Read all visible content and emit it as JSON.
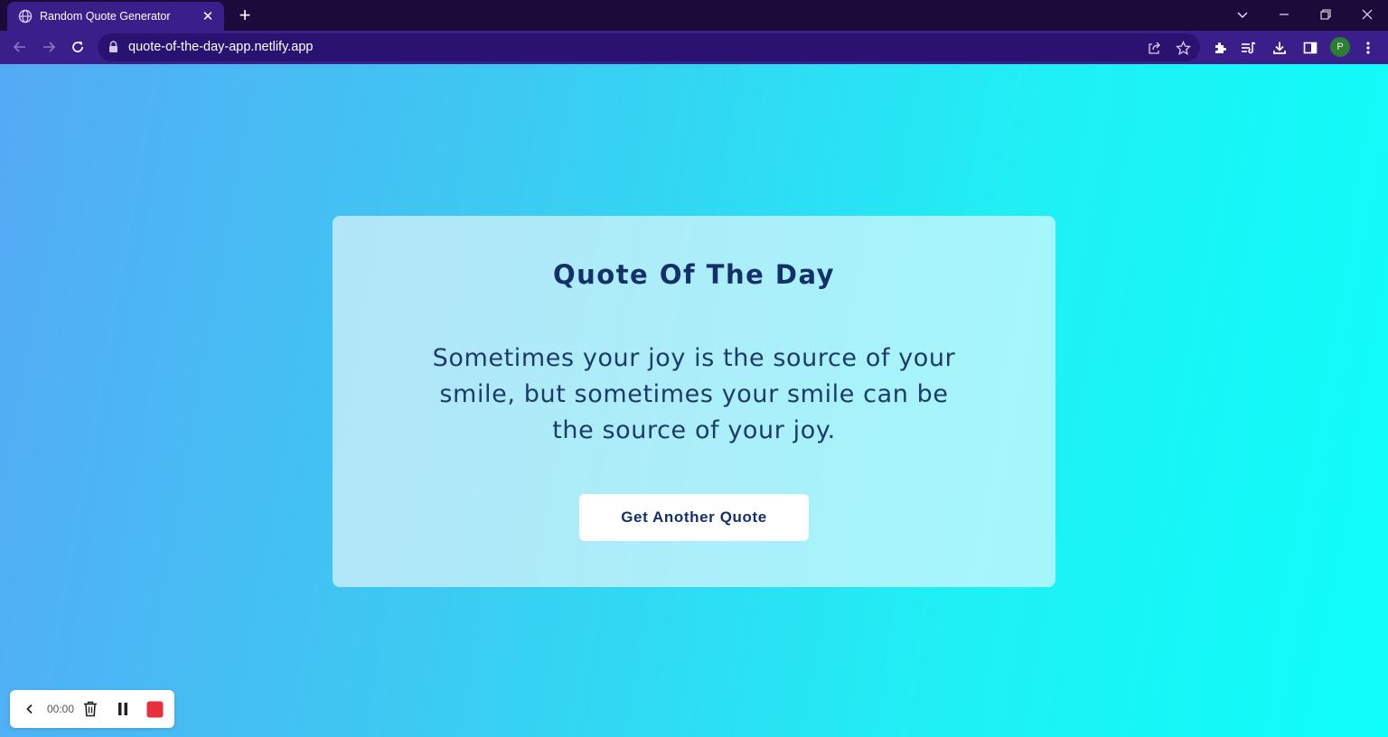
{
  "browser": {
    "tab": {
      "title": "Random Quote Generator",
      "favicon": "globe-icon"
    },
    "url": "quote-of-the-day-app.netlify.app",
    "profile_initial": "P",
    "colors": {
      "frame": "#1b0a3a",
      "toolbar": "#3a1f8a",
      "omnibox": "#2a1270"
    }
  },
  "page": {
    "title": "Quote Of The Day",
    "quote": "Sometimes your joy is the source of your smile, but sometimes your smile can be the source of your joy.",
    "button_label": "Get Another Quote",
    "colors": {
      "text": "#14306a",
      "gradient_start": "#55aaf5",
      "gradient_end": "#0dfdfa"
    }
  },
  "recorder": {
    "time": "00:00",
    "icons": [
      "chevron-left-icon",
      "trash-icon",
      "pause-icon",
      "stop-icon"
    ],
    "stop_color": "#e8303c"
  }
}
